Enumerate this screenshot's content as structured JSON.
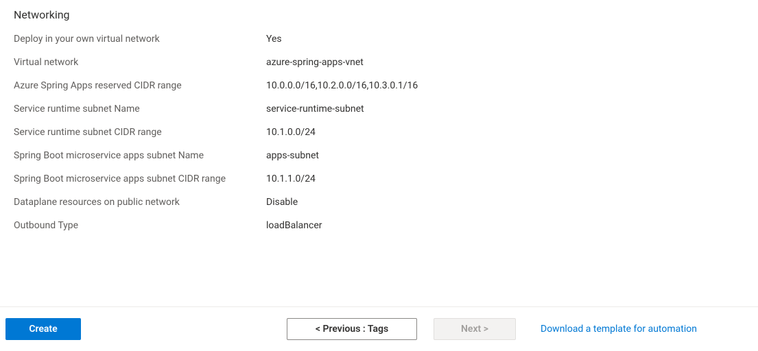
{
  "section": {
    "title": "Networking"
  },
  "fields": {
    "deployVnet": {
      "label": "Deploy in your own virtual network",
      "value": "Yes"
    },
    "vnet": {
      "label": "Virtual network",
      "value": "azure-spring-apps-vnet"
    },
    "cidrRange": {
      "label": "Azure Spring Apps reserved CIDR range",
      "value": "10.0.0.0/16,10.2.0.0/16,10.3.0.1/16"
    },
    "runtimeSubnetName": {
      "label": "Service runtime subnet Name",
      "value": "service-runtime-subnet"
    },
    "runtimeSubnetCidr": {
      "label": "Service runtime subnet CIDR range",
      "value": "10.1.0.0/24"
    },
    "appsSubnetName": {
      "label": "Spring Boot microservice apps subnet Name",
      "value": "apps-subnet"
    },
    "appsSubnetCidr": {
      "label": "Spring Boot microservice apps subnet CIDR range",
      "value": "10.1.1.0/24"
    },
    "dataplane": {
      "label": "Dataplane resources on public network",
      "value": "Disable"
    },
    "outboundType": {
      "label": "Outbound Type",
      "value": "loadBalancer"
    }
  },
  "footer": {
    "create": "Create",
    "previous": "< Previous : Tags",
    "next": "Next >",
    "download": "Download a template for automation"
  }
}
